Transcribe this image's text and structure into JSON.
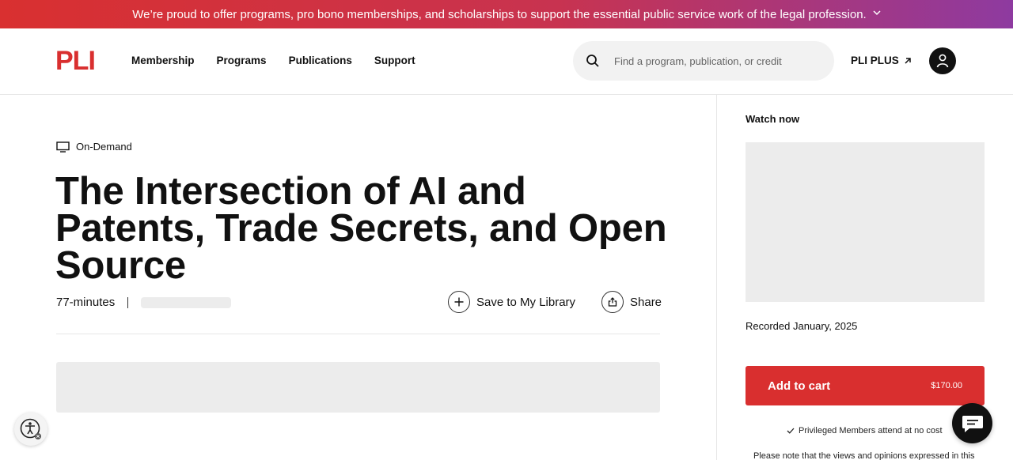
{
  "banner": {
    "text": "We’re proud to offer programs, pro bono memberships, and scholarships to support the essential public service work of the legal profession.",
    "chevron": "⌄"
  },
  "header": {
    "logo": "PLI",
    "nav": [
      "Membership",
      "Programs",
      "Publications",
      "Support"
    ],
    "search_placeholder": "Find a program, publication, or credit",
    "plus_label": "PLI PLUS",
    "icons": {
      "search": "search-icon",
      "external": "arrow-up-right-icon",
      "account": "user-icon"
    }
  },
  "program": {
    "format": "On-Demand",
    "title": "The Intersection of AI and Patents, Trade Secrets, and Open Source",
    "duration": "77-minutes",
    "save_label": "Save to My Library",
    "share_label": "Share"
  },
  "sidebar": {
    "watch_label": "Watch now",
    "recorded": "Recorded January, 2025",
    "cart_label": "Add to cart",
    "price": "$170.00",
    "privileged_note": "Privileged Members attend at no cost",
    "disclaimer": "Please note that the views and opinions expressed in this"
  },
  "colors": {
    "brand": "#d92f2f",
    "banner_start": "#d93030",
    "banner_end": "#8e3aa0"
  }
}
